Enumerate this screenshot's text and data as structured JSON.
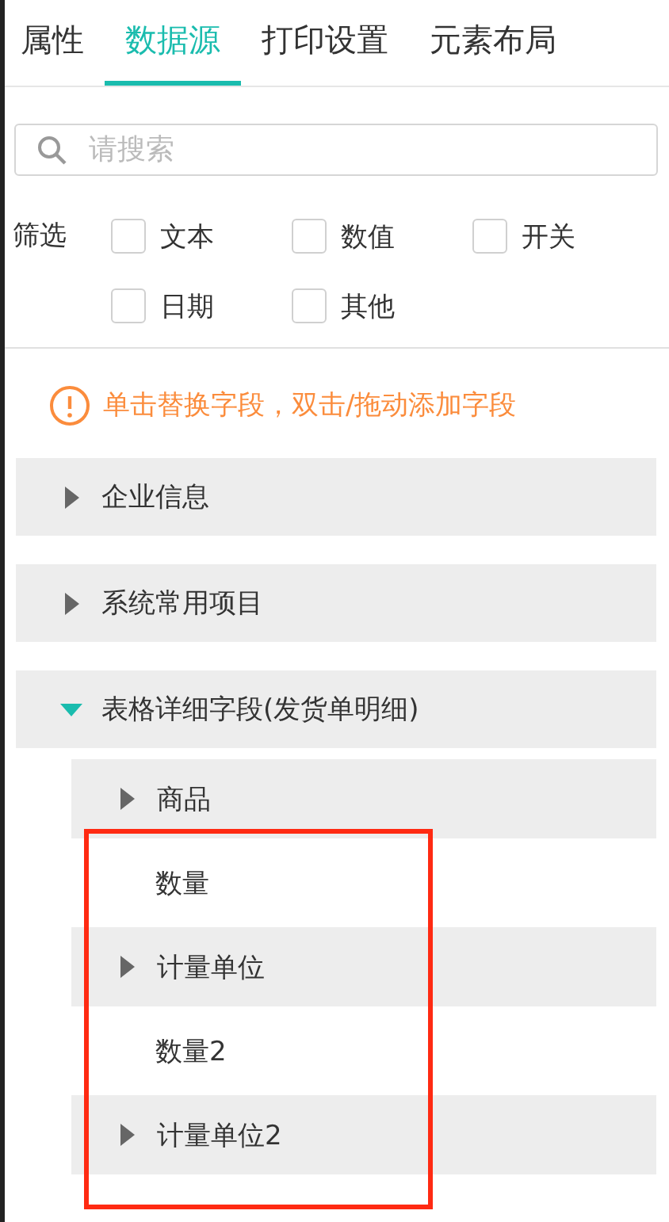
{
  "tabs": [
    {
      "label": "属性",
      "selected": false
    },
    {
      "label": "数据源",
      "selected": true
    },
    {
      "label": "打印设置",
      "selected": false
    },
    {
      "label": "元素布局",
      "selected": false
    }
  ],
  "search": {
    "placeholder": "请搜索"
  },
  "filter": {
    "label": "筛选",
    "options": [
      {
        "label": "文本",
        "checked": false
      },
      {
        "label": "数值",
        "checked": false
      },
      {
        "label": "开关",
        "checked": false
      },
      {
        "label": "日期",
        "checked": false
      },
      {
        "label": "其他",
        "checked": false
      }
    ]
  },
  "notice": "单击替换字段，双击/拖动添加字段",
  "tree": [
    {
      "label": "企业信息",
      "expanded": false
    },
    {
      "label": "系统常用项目",
      "expanded": false
    },
    {
      "label": "表格详细字段(发货单明细)",
      "expanded": true,
      "children": [
        {
          "label": "商品",
          "expanded": false
        },
        {
          "label": "数量"
        },
        {
          "label": "计量单位",
          "expanded": false
        },
        {
          "label": "数量2"
        },
        {
          "label": "计量单位2",
          "expanded": false
        }
      ]
    }
  ]
}
